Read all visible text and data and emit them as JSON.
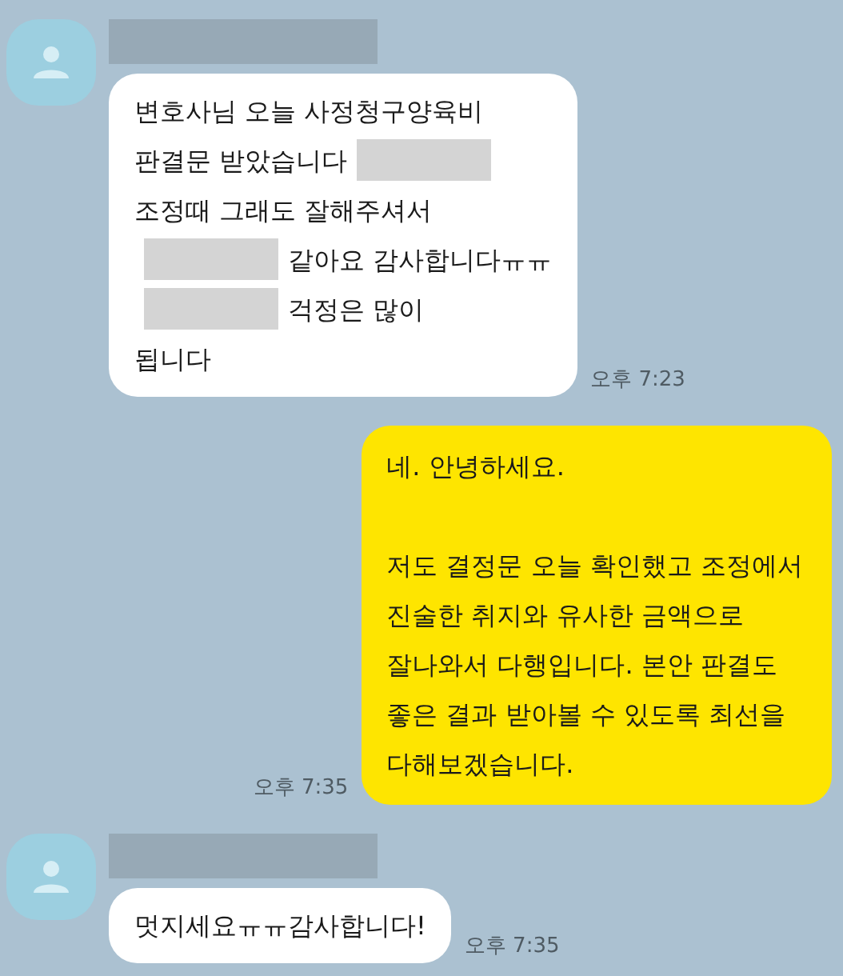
{
  "messages": [
    {
      "kind": "received",
      "sender_redacted": true,
      "time": "오후 7:23",
      "paragraphs": [
        [
          [
            {
              "kind": "text",
              "text": "변호사님 오늘 사정청구양육비"
            }
          ],
          [
            {
              "kind": "text",
              "text": "판결문 받았습니다"
            },
            {
              "kind": "redacted"
            }
          ],
          [
            {
              "kind": "text",
              "text": "조정때 그래도 잘해주셔서"
            }
          ],
          [
            {
              "kind": "redacted"
            },
            {
              "kind": "text",
              "text": "같아요 감사합니다ㅠㅠ"
            }
          ],
          [
            {
              "kind": "redacted"
            },
            {
              "kind": "text",
              "text": "걱정은 많이"
            }
          ],
          [
            {
              "kind": "text",
              "text": "됩니다"
            }
          ]
        ]
      ]
    },
    {
      "kind": "sent",
      "time": "오후 7:35",
      "paragraphs": [
        [
          [
            {
              "kind": "text",
              "text": "네. 안녕하세요."
            }
          ]
        ],
        [
          [
            {
              "kind": "text",
              "text": "저도 결정문 오늘 확인했고 조정에서"
            }
          ],
          [
            {
              "kind": "text",
              "text": "진술한 취지와 유사한 금액으로"
            }
          ],
          [
            {
              "kind": "text",
              "text": "잘나와서 다행입니다. 본안 판결도"
            }
          ],
          [
            {
              "kind": "text",
              "text": "좋은 결과 받아볼 수 있도록 최선을"
            }
          ],
          [
            {
              "kind": "text",
              "text": "다해보겠습니다."
            }
          ]
        ]
      ]
    },
    {
      "kind": "received",
      "sender_redacted": true,
      "time": "오후 7:35",
      "paragraphs": [
        [
          [
            {
              "kind": "text",
              "text": "멋지세요ㅠㅠ감사합니다!"
            }
          ]
        ]
      ]
    }
  ]
}
